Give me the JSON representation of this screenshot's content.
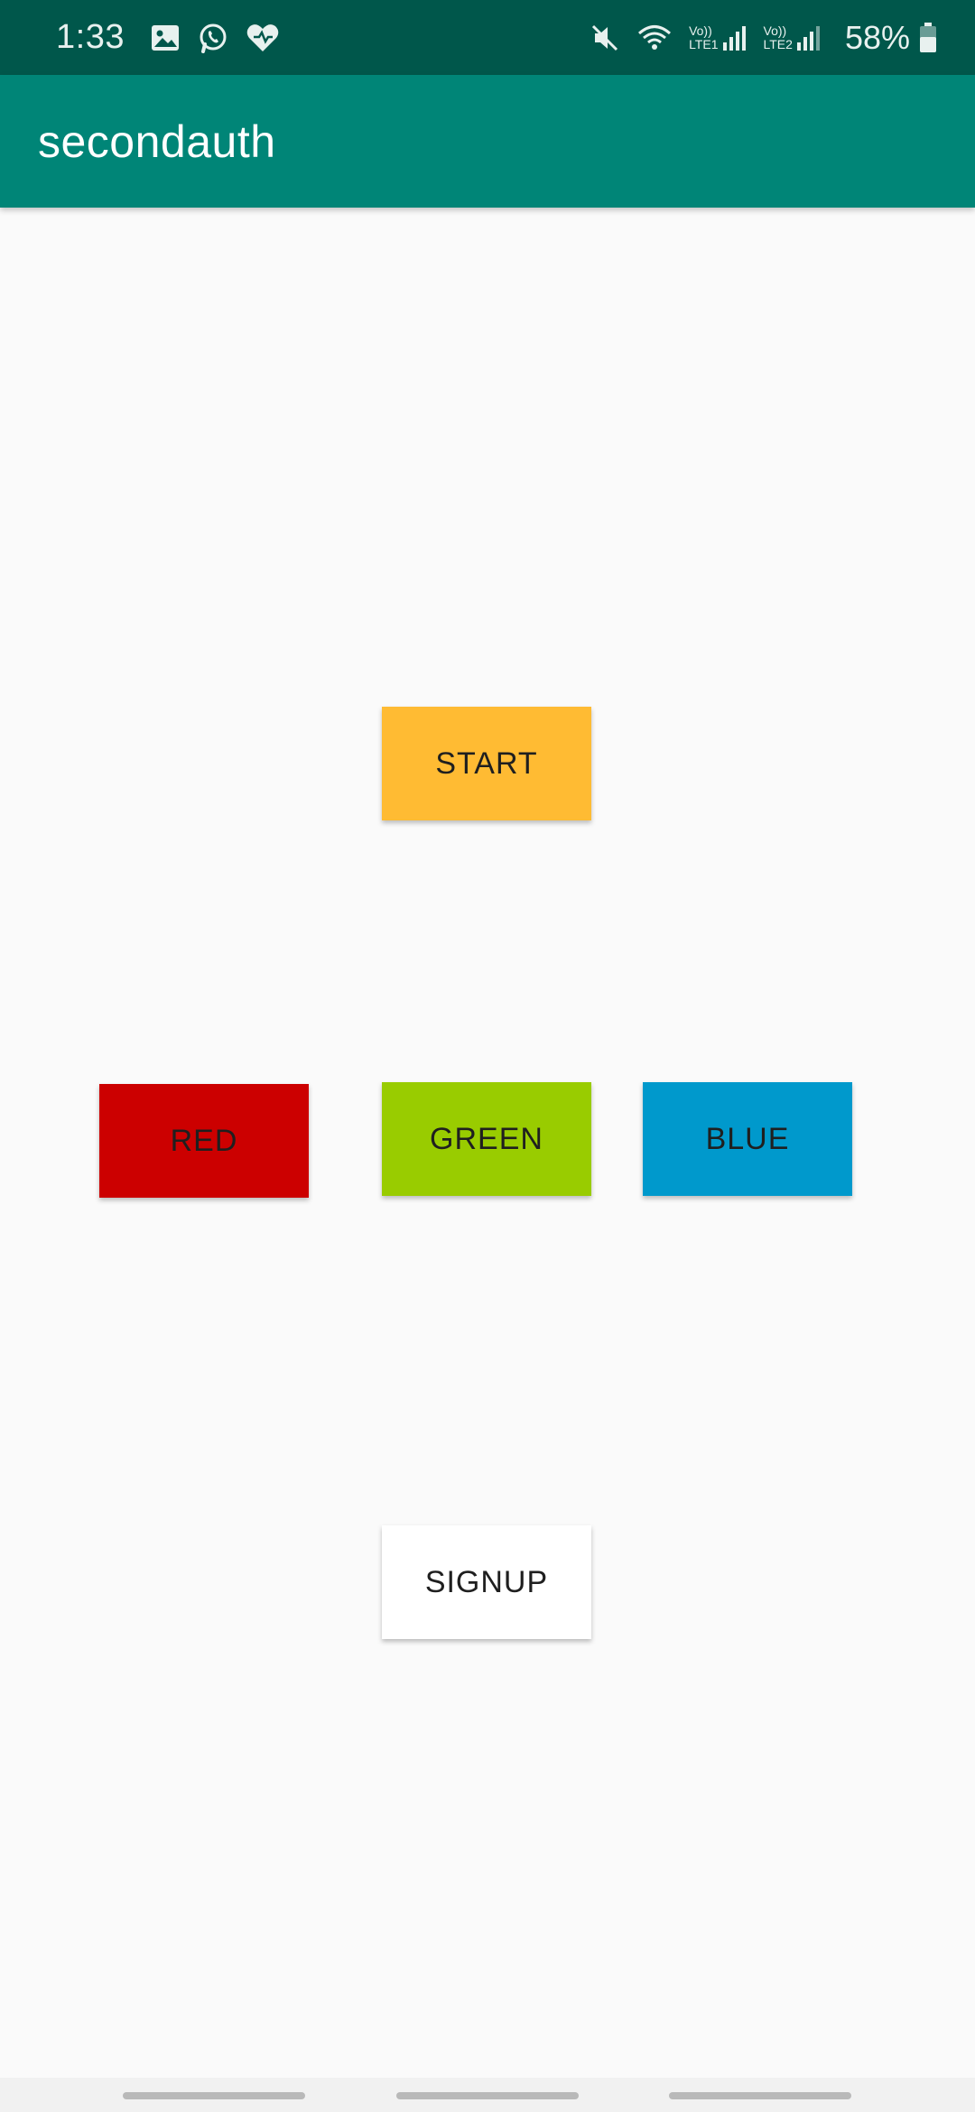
{
  "status_bar": {
    "time": "1:33",
    "left_icons": [
      "gallery-icon",
      "whatsapp-icon",
      "health-heart-icon"
    ],
    "right_icons": [
      "mute-icon",
      "wifi-icon",
      "signal-icon"
    ],
    "sim1": {
      "top": "Vo))",
      "bottom": "LTE1"
    },
    "sim2": {
      "top": "Vo))",
      "bottom": "LTE2"
    },
    "battery_percent_text": "58%",
    "battery_level": 0.58
  },
  "app_bar": {
    "title": "secondauth",
    "color": "#008577"
  },
  "buttons": {
    "start": {
      "label": "START",
      "color": "#ffbb33"
    },
    "red": {
      "label": "RED",
      "color": "#cc0000"
    },
    "green": {
      "label": "GREEN",
      "color": "#99cc00"
    },
    "blue": {
      "label": "BLUE",
      "color": "#0099cc"
    },
    "signup": {
      "label": "SIGNUP",
      "color": "#ffffff"
    }
  },
  "colors": {
    "status_bar": "#00574b",
    "background": "#fafafa",
    "nav_bar": "#f1f1f1"
  }
}
